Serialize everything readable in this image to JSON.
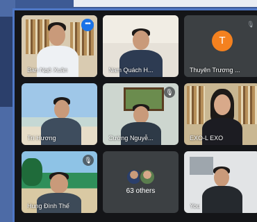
{
  "meeting": {
    "tiles": [
      {
        "name": "Ban Ngô Xuân",
        "state": "active-speaker",
        "menu_icon": "more-dots-icon"
      },
      {
        "name": "Nam Quách H..."
      },
      {
        "name": "Thuyên Trương ...",
        "avatar_letter": "T",
        "avatar_color": "#f4811f",
        "muted": true
      },
      {
        "name": "Trí Hương"
      },
      {
        "name": "Cường Nguyễ...",
        "muted": true
      },
      {
        "name": "EXO-L EXO"
      },
      {
        "name": "Hung Đình Thế",
        "muted": true
      },
      {
        "name": "63 others"
      },
      {
        "name": "You"
      }
    ]
  },
  "colors": {
    "frame_bg": "#141518",
    "tile_bg": "#3c4043",
    "active_border": "#8ab4f8",
    "accent": "#1a73e8"
  }
}
